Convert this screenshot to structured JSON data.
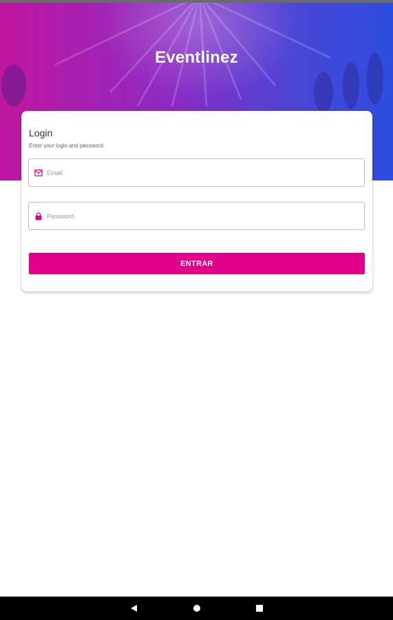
{
  "app": {
    "title": "Eventlinez"
  },
  "login": {
    "title": "Login",
    "subtitle": "Enter your login and password.",
    "email_placeholder": "Email",
    "password_placeholder": "Password",
    "submit_label": "ENTRAR"
  },
  "icons": {
    "email": "envelope-icon",
    "password": "lock-icon",
    "nav_back": "back-triangle-icon",
    "nav_home": "home-circle-icon",
    "nav_recents": "recents-square-icon"
  },
  "colors": {
    "accent": "#e0008a",
    "hero_start": "#c0169f",
    "hero_end": "#2d4ee0",
    "nav_bar": "#000000"
  }
}
